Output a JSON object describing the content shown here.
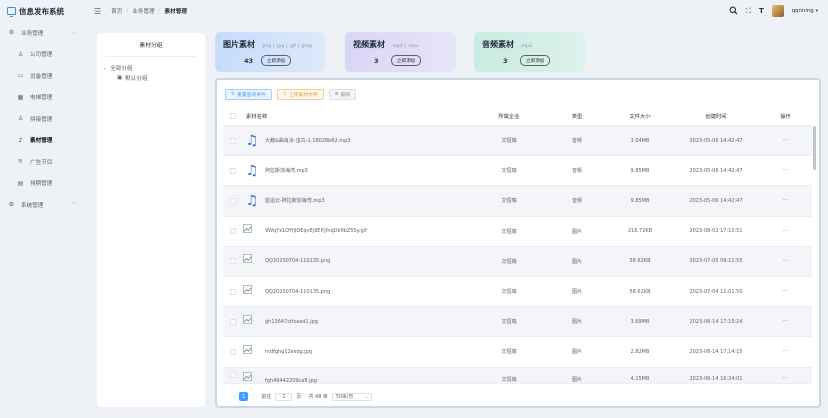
{
  "app": {
    "title": "信息发布系统"
  },
  "sidebar": {
    "items": [
      {
        "label": "业务管理",
        "icon": "gear-icon"
      },
      {
        "label": "公司管理",
        "icon": "org-icon"
      },
      {
        "label": "设备管理",
        "icon": "monitor-icon"
      },
      {
        "label": "电梯管理",
        "icon": "grid-icon"
      },
      {
        "label": "拼接管理",
        "icon": "org-icon"
      },
      {
        "label": "素材管理",
        "icon": "music-note-icon"
      },
      {
        "label": "广告节目",
        "icon": "megaphone-icon"
      },
      {
        "label": "排期管理",
        "icon": "calendar-icon"
      },
      {
        "label": "系统管理",
        "icon": "gear-icon"
      }
    ]
  },
  "header": {
    "breadcrumb": [
      "首页",
      "业务管理",
      "素材管理"
    ],
    "user": "qqnning"
  },
  "category": {
    "title": "素材分组",
    "root": "全部分组",
    "child": "默认分组"
  },
  "cards": [
    {
      "title": "图片素材",
      "ext": ".png | .jpg | .gif | .jpeg",
      "count": "43",
      "button": "立即添加",
      "color": "#cfe2fb"
    },
    {
      "title": "视频素材",
      "ext": ".mp4 | .mov",
      "count": "3",
      "button": "立即添加",
      "color": "#dedcf6"
    },
    {
      "title": "音频素材",
      "ext": ".mp3",
      "count": "3",
      "button": "立即添加",
      "color": "#cfeee6"
    }
  ],
  "toolbar": {
    "reset": "重置查询条件",
    "upload": "上传素材文件",
    "delete": "删除"
  },
  "table": {
    "headers": [
      "素材名称",
      "所属企业",
      "类型",
      "文件大小",
      "创建时间",
      "操作"
    ],
    "rows": [
      {
        "name": "大藉&曲肖冰-虫鸟-1.18028b62.mp3",
        "ent": "文恒瑞",
        "type": "音频",
        "size": "3.04MB",
        "time": "2023-05-06 14:42:47",
        "op": "···"
      },
      {
        "name": "阿拉斯加海湾.mp3",
        "ent": "文恒瑞",
        "type": "音频",
        "size": "9.85MB",
        "time": "2023-05-06 14:42:47",
        "op": "···"
      },
      {
        "name": "蓝遥云-阿拉斯加海湾.mp3",
        "ent": "文恒瑞",
        "type": "音频",
        "size": "9.85MB",
        "time": "2023-05-06 14:42:47",
        "op": "···"
      },
      {
        "name": "9WqYz1OYfjlDEqvEj9EP.jfnqDkfIbZ5Sy.gif",
        "ent": "文恒瑞",
        "type": "图片",
        "size": "216.72KB",
        "time": "2023-08-02 17:10:51",
        "op": "···"
      },
      {
        "name": "QQ20230704-110135.png",
        "ent": "文恒瑞",
        "type": "图片",
        "size": "58.62KB",
        "time": "2023-07-05 09:11:55",
        "op": "···"
      },
      {
        "name": "QQ20230704-110135.png",
        "ent": "文恒瑞",
        "type": "图片",
        "size": "58.62KB",
        "time": "2023-07-04 11:01:50",
        "op": "···"
      },
      {
        "name": "gh13647stfoasd1.jpg",
        "ent": "文恒瑞",
        "type": "图片",
        "size": "3.69MB",
        "time": "2023-06-14 17:15:24",
        "op": "···"
      },
      {
        "name": "mdfghg12esdg.jpg",
        "ent": "文恒瑞",
        "type": "图片",
        "size": "2.82MB",
        "time": "2023-06-14 17:14:15",
        "op": "···"
      },
      {
        "name": "fgh49442209ca8.jpg",
        "ent": "文恒瑞",
        "type": "图片",
        "size": "4.15MB",
        "time": "2023-06-14 16:24:01",
        "op": "···"
      }
    ]
  },
  "pager": {
    "current": "1",
    "goto": "前往",
    "page_value": "1",
    "page_unit": "页",
    "total": "共 48 条",
    "size": "50条/页"
  }
}
